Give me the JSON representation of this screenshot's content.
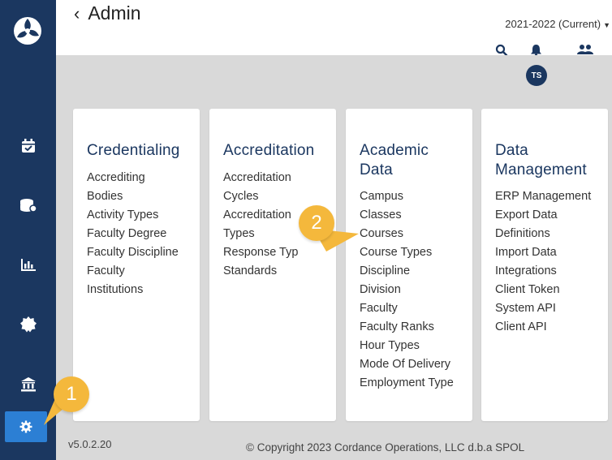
{
  "header": {
    "back_label": "Admin",
    "year_selector": "2021-2022 (Current)",
    "avatar_initials": "TS",
    "partial_text": "................"
  },
  "sidebar": {
    "items": [
      {
        "icon": "calendar-check-icon"
      },
      {
        "icon": "database-icon"
      },
      {
        "icon": "bar-chart-icon"
      },
      {
        "icon": "badge-icon"
      },
      {
        "icon": "institution-icon"
      },
      {
        "icon": "gear-icon",
        "active": true
      }
    ]
  },
  "cards": [
    {
      "title": "Credentialing",
      "items": [
        "Accrediting",
        "Bodies",
        "Activity Types",
        "Faculty Degree",
        "Faculty Discipline",
        "Faculty",
        "Institutions"
      ]
    },
    {
      "title": "Accreditation",
      "items": [
        "Accreditation",
        "Cycles",
        "Accreditation",
        "Types",
        "Response Typ",
        "Standards"
      ]
    },
    {
      "title_lines": [
        "Academic",
        "Data"
      ],
      "items": [
        "Campus",
        "Classes",
        "Courses",
        "Course Types",
        "Discipline",
        "Division",
        "Faculty",
        "Faculty Ranks",
        "Hour Types",
        "Mode Of Delivery",
        "Employment Type"
      ]
    },
    {
      "title_lines": [
        "Data",
        "Management"
      ],
      "items": [
        "ERP Management",
        "Export Data",
        "Definitions",
        "Import Data",
        "Integrations",
        "Client Token",
        "System API",
        "Client API"
      ]
    }
  ],
  "footer": {
    "version": "v5.0.2.20",
    "copyright": "© Copyright 2023 Cordance Operations, LLC d.b.a SPOL"
  },
  "callouts": [
    "1",
    "2"
  ],
  "colors": {
    "sidebar": "#1b3760",
    "active": "#2c7fd4",
    "heading": "#1b3760",
    "callout": "#f4b83c",
    "gray": "#d9d9d9"
  }
}
